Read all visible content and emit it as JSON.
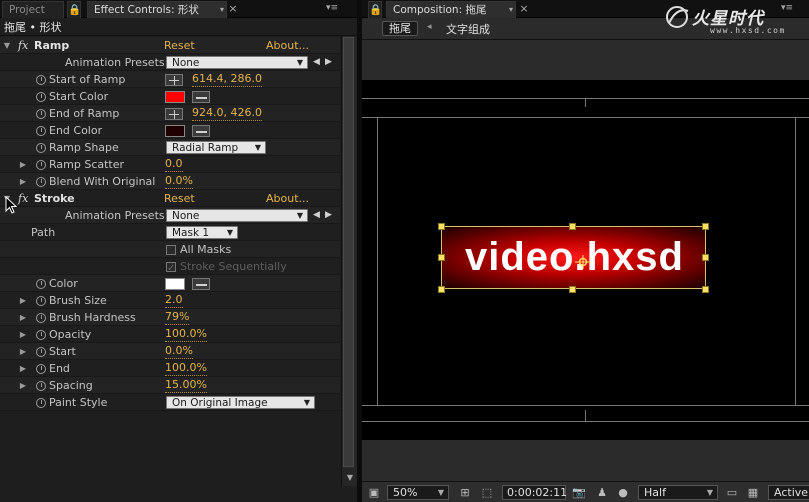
{
  "left_tabs": {
    "project": "Project",
    "effect_controls": "Effect Controls: 形状",
    "close": "×",
    "menu": "▾≡"
  },
  "layer_path": "拖尾 • 形状",
  "ramp": {
    "name": "Ramp",
    "fx": "fx",
    "reset": "Reset",
    "about": "About...",
    "animation_presets_label": "Animation Presets:",
    "animation_presets_value": "None",
    "start_of_ramp_label": "Start of Ramp",
    "start_of_ramp_value": "614.4, 286.0",
    "start_color_label": "Start Color",
    "start_color": "#ff0000",
    "end_of_ramp_label": "End of Ramp",
    "end_of_ramp_value": "924.0, 426.0",
    "end_color_label": "End Color",
    "end_color": "#200000",
    "ramp_shape_label": "Ramp Shape",
    "ramp_shape_value": "Radial Ramp",
    "ramp_scatter_label": "Ramp Scatter",
    "ramp_scatter_value": "0.0",
    "blend_label": "Blend With Original",
    "blend_value": "0.0%"
  },
  "stroke": {
    "name": "Stroke",
    "fx": "fx",
    "reset": "Reset",
    "about": "About...",
    "animation_presets_label": "Animation Presets:",
    "animation_presets_value": "None",
    "path_label": "Path",
    "path_value": "Mask 1",
    "all_masks_label": "All Masks",
    "stroke_sequentially_label": "Stroke Sequentially",
    "color_label": "Color",
    "color": "#ffffff",
    "brush_size_label": "Brush Size",
    "brush_size_value": "2.0",
    "brush_hardness_label": "Brush Hardness",
    "brush_hardness_value": "79%",
    "opacity_label": "Opacity",
    "opacity_value": "100.0%",
    "start_label": "Start",
    "start_value": "0.0%",
    "end_label": "End",
    "end_value": "100.0%",
    "spacing_label": "Spacing",
    "spacing_value": "15.00%",
    "paint_style_label": "Paint Style",
    "paint_style_value": "On Original Image"
  },
  "right_tabs": {
    "composition": "Composition: 拖尾",
    "close": "×",
    "menu": "▾≡"
  },
  "comp_toolbar": {
    "current_comp": "拖尾",
    "arrow": "◂",
    "nested_comp": "文字组成"
  },
  "brand": {
    "name": "火星时代",
    "url": "www.hxsd.com"
  },
  "canvas": {
    "layer_text": "video.hxsd"
  },
  "bottom_bar": {
    "zoom": "50%",
    "timecode": "0:00:02:11",
    "resolution": "Half",
    "camera": "Active"
  }
}
